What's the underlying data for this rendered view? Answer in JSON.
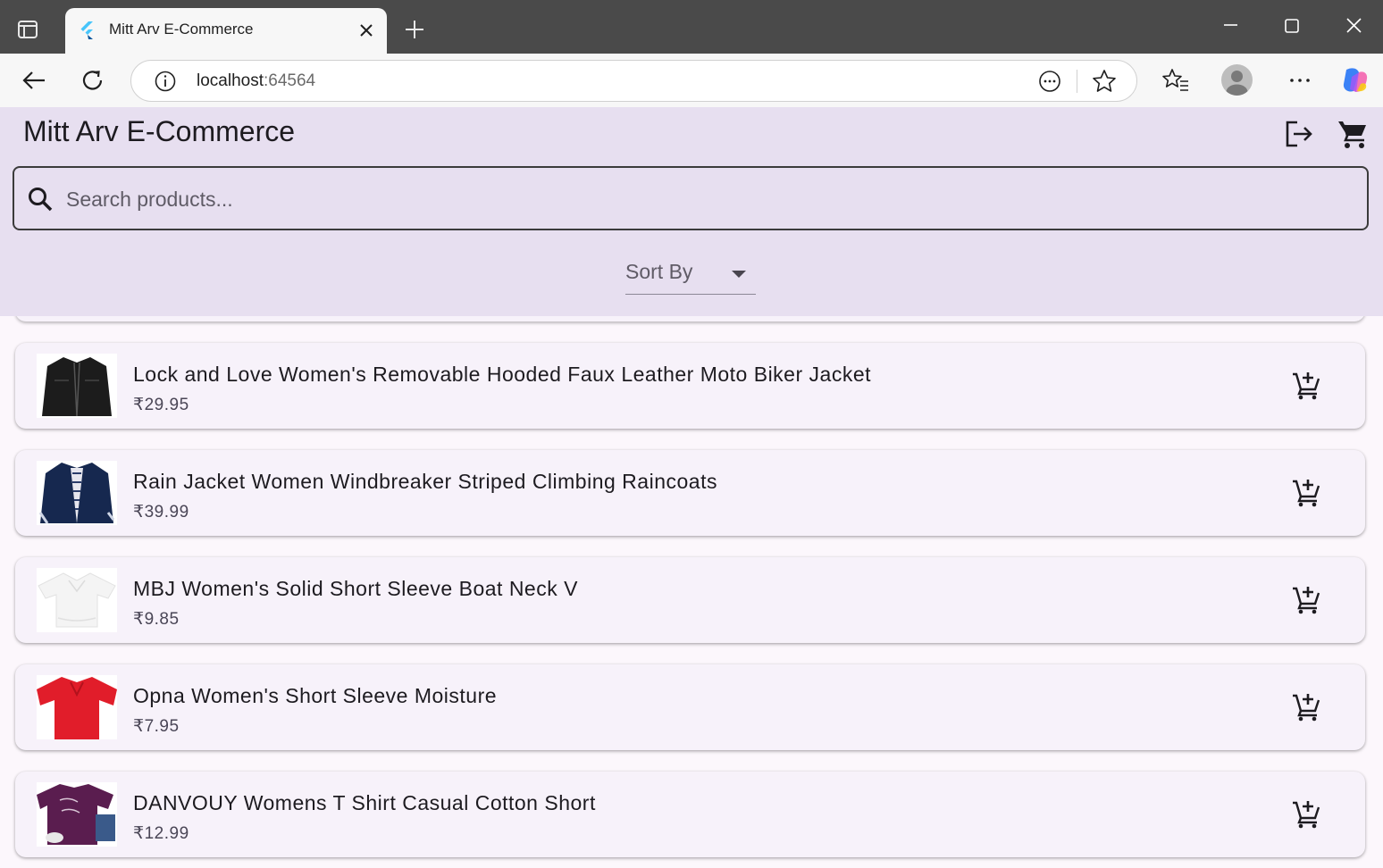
{
  "browser": {
    "tab_title": "Mitt Arv E-Commerce",
    "url_host": "localhost",
    "url_port": ":64564"
  },
  "app": {
    "title": "Mitt Arv E-Commerce",
    "search_placeholder": "Search products...",
    "sort_label": "Sort By",
    "accent_color": "#e7dff0"
  },
  "products": [
    {
      "name": "Lock and Love Women's Removable Hooded Faux Leather Moto Biker Jacket",
      "price": "₹29.95",
      "image": "black-leather-jacket"
    },
    {
      "name": "Rain Jacket Women Windbreaker Striped Climbing Raincoats",
      "price": "₹39.99",
      "image": "navy-striped-jacket"
    },
    {
      "name": "MBJ Women's Solid Short Sleeve Boat Neck V",
      "price": "₹9.85",
      "image": "white-top"
    },
    {
      "name": "Opna Women's Short Sleeve Moisture",
      "price": "₹7.95",
      "image": "red-polo"
    },
    {
      "name": "DANVOUY Womens T Shirt Casual Cotton Short",
      "price": "₹12.99",
      "image": "purple-tshirt"
    }
  ]
}
